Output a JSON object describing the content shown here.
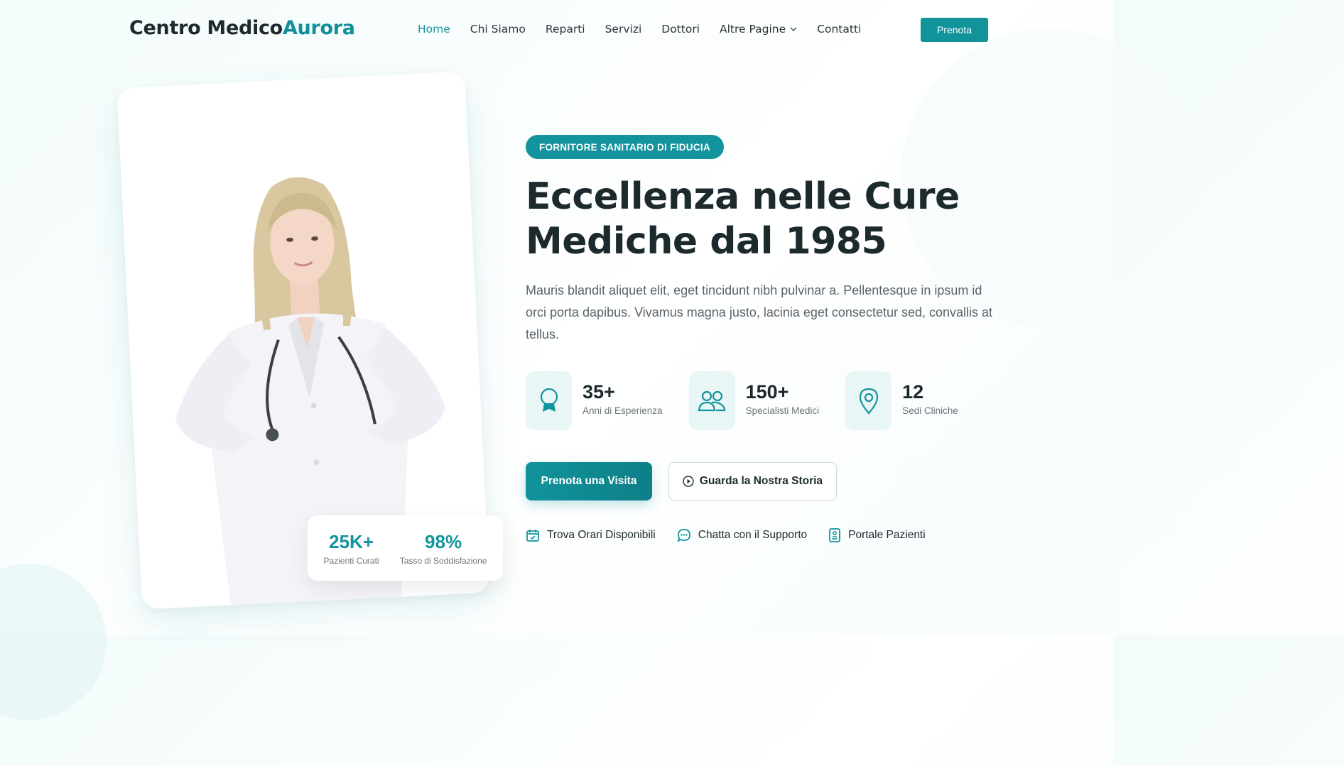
{
  "brand": {
    "name_main": "Centro Medico",
    "name_accent": "Aurora",
    "accent_color": "#11939c"
  },
  "nav": {
    "items": [
      {
        "label": "Home",
        "active": true
      },
      {
        "label": "Chi Siamo"
      },
      {
        "label": "Reparti"
      },
      {
        "label": "Servizi"
      },
      {
        "label": "Dottori"
      },
      {
        "label": "Altre Pagine",
        "dropdown": true
      },
      {
        "label": "Contatti"
      }
    ],
    "cta_label": "Prenota"
  },
  "hero": {
    "badge": "FORNITORE SANITARIO DI FIDUCIA",
    "title_line1": "Eccellenza nelle Cure",
    "title_line2": "Mediche dal 1985",
    "description": "Mauris blandit aliquet elit, eget tincidunt nibh pulvinar a. Pellentesque in ipsum id orci porta dapibus. Vivamus magna justo, lacinia eget consectetur sed, convallis at tellus.",
    "stats": [
      {
        "icon": "award-icon",
        "value": "35+",
        "label": "Anni di Esperienza"
      },
      {
        "icon": "users-icon",
        "value": "150+",
        "label": "Specialisti Medici"
      },
      {
        "icon": "map-pin-icon",
        "value": "12",
        "label": "Sedi Cliniche"
      }
    ],
    "primary_cta": "Prenota una Visita",
    "secondary_cta": "Guarda la Nostra Storia",
    "quick_links": [
      {
        "icon": "calendar-icon",
        "label": "Trova Orari Disponibili"
      },
      {
        "icon": "chat-icon",
        "label": "Chatta con il Supporto"
      },
      {
        "icon": "portal-icon",
        "label": "Portale Pazienti"
      }
    ]
  },
  "floating_stats": [
    {
      "value": "25K+",
      "label": "Pazienti Curati"
    },
    {
      "value": "98%",
      "label": "Tasso di Soddisfazione"
    }
  ]
}
